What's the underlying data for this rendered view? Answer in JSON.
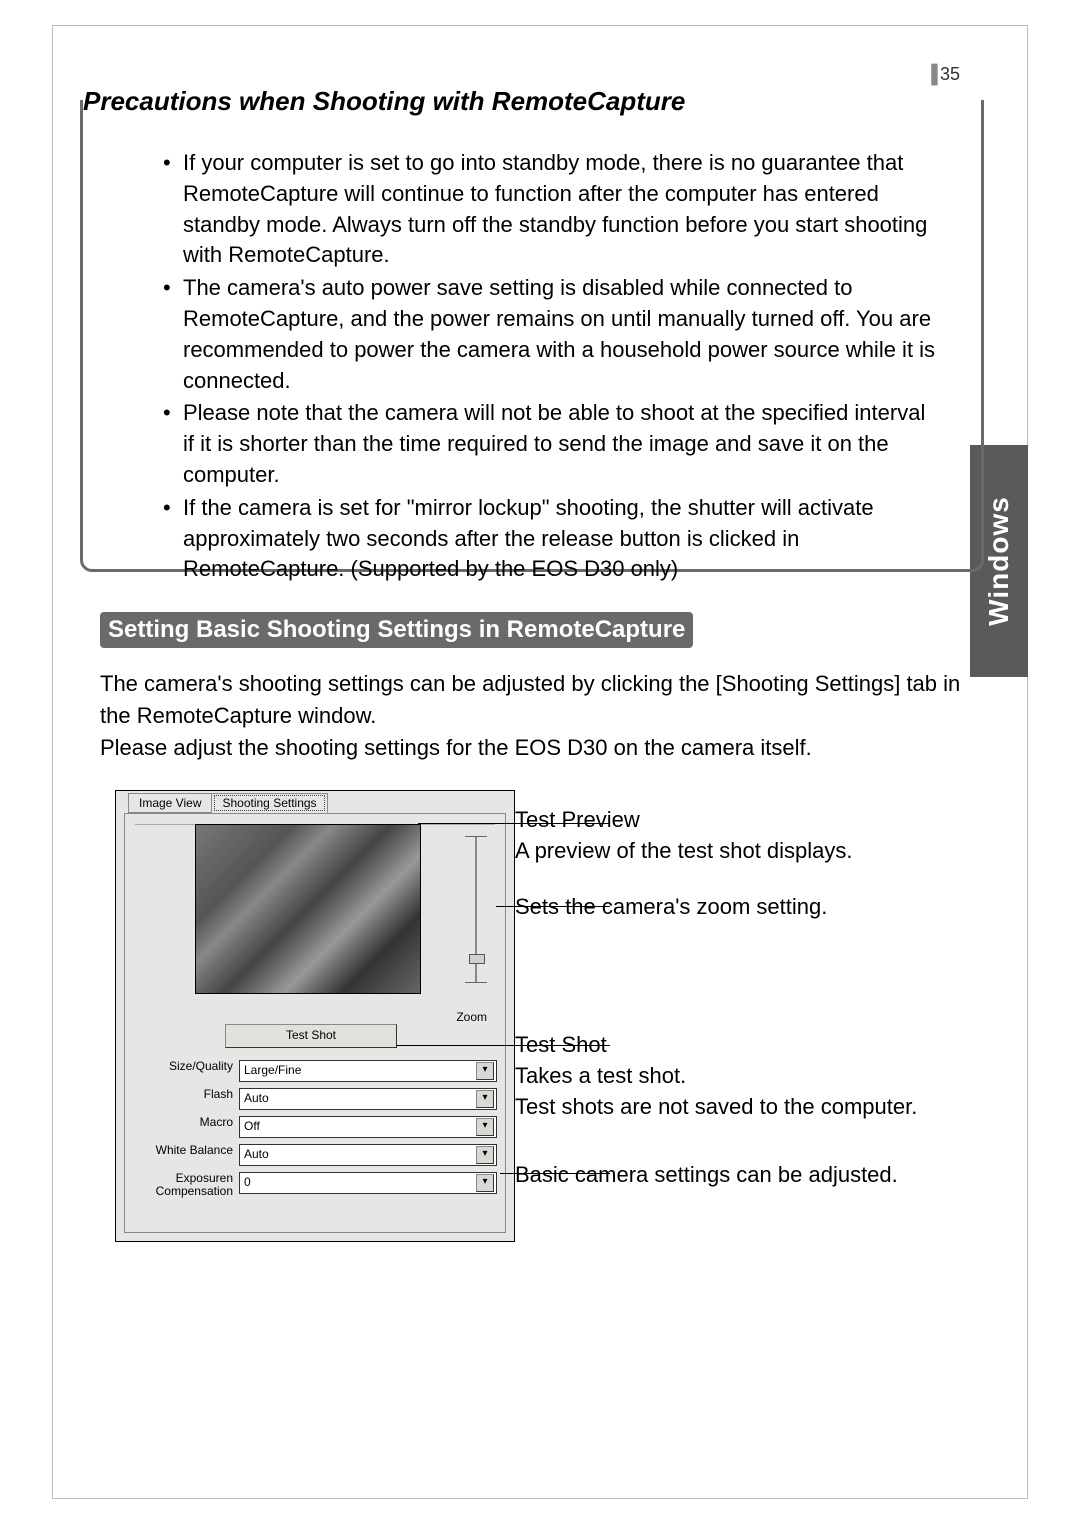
{
  "page_number": "35",
  "side_tab": "Windows",
  "precautions": {
    "title": "Precautions when Shooting with RemoteCapture",
    "items": [
      "If your computer is set to go into standby mode, there is no guarantee that RemoteCapture will continue to function after the computer has entered standby mode. Always turn off the standby function before you start shooting with RemoteCapture.",
      "The camera's auto power save setting is disabled while connected to RemoteCapture, and the power remains on until manually turned off. You are recommended to power the camera with a household power source while it is connected.",
      "Please note that the camera will not be able to shoot at the specified interval if it is shorter than the time required to send the image and save it on the computer.",
      "If the camera is set for \"mirror lockup\" shooting, the shutter will activate approximately two seconds after the release button is clicked in RemoteCapture. (Supported by the EOS D30 only)"
    ]
  },
  "section_heading": "Setting Basic Shooting Settings in RemoteCapture",
  "body_text": "The camera's shooting settings can be adjusted by clicking the [Shooting Settings] tab in the RemoteCapture window.\nPlease adjust the shooting settings for the EOS D30 on the camera itself.",
  "screenshot": {
    "tabs": {
      "image_view": "Image View",
      "shooting_settings": "Shooting Settings"
    },
    "zoom_label": "Zoom",
    "test_shot_button": "Test Shot",
    "settings": [
      {
        "label": "Size/Quality",
        "value": "Large/Fine"
      },
      {
        "label": "Flash",
        "value": "Auto"
      },
      {
        "label": "Macro",
        "value": "Off"
      },
      {
        "label": "White Balance",
        "value": "Auto"
      },
      {
        "label": "Exposuren Compensation",
        "value": "0"
      }
    ]
  },
  "callouts": {
    "preview_title": "Test Preview",
    "preview_desc": "A preview of the test shot displays.",
    "zoom_desc": "Sets the camera's zoom setting.",
    "testshot_title": "Test Shot",
    "testshot_desc1": "Takes a test shot.",
    "testshot_desc2": "Test shots are not saved to the computer.",
    "settings_desc": "Basic camera settings can be adjusted."
  }
}
